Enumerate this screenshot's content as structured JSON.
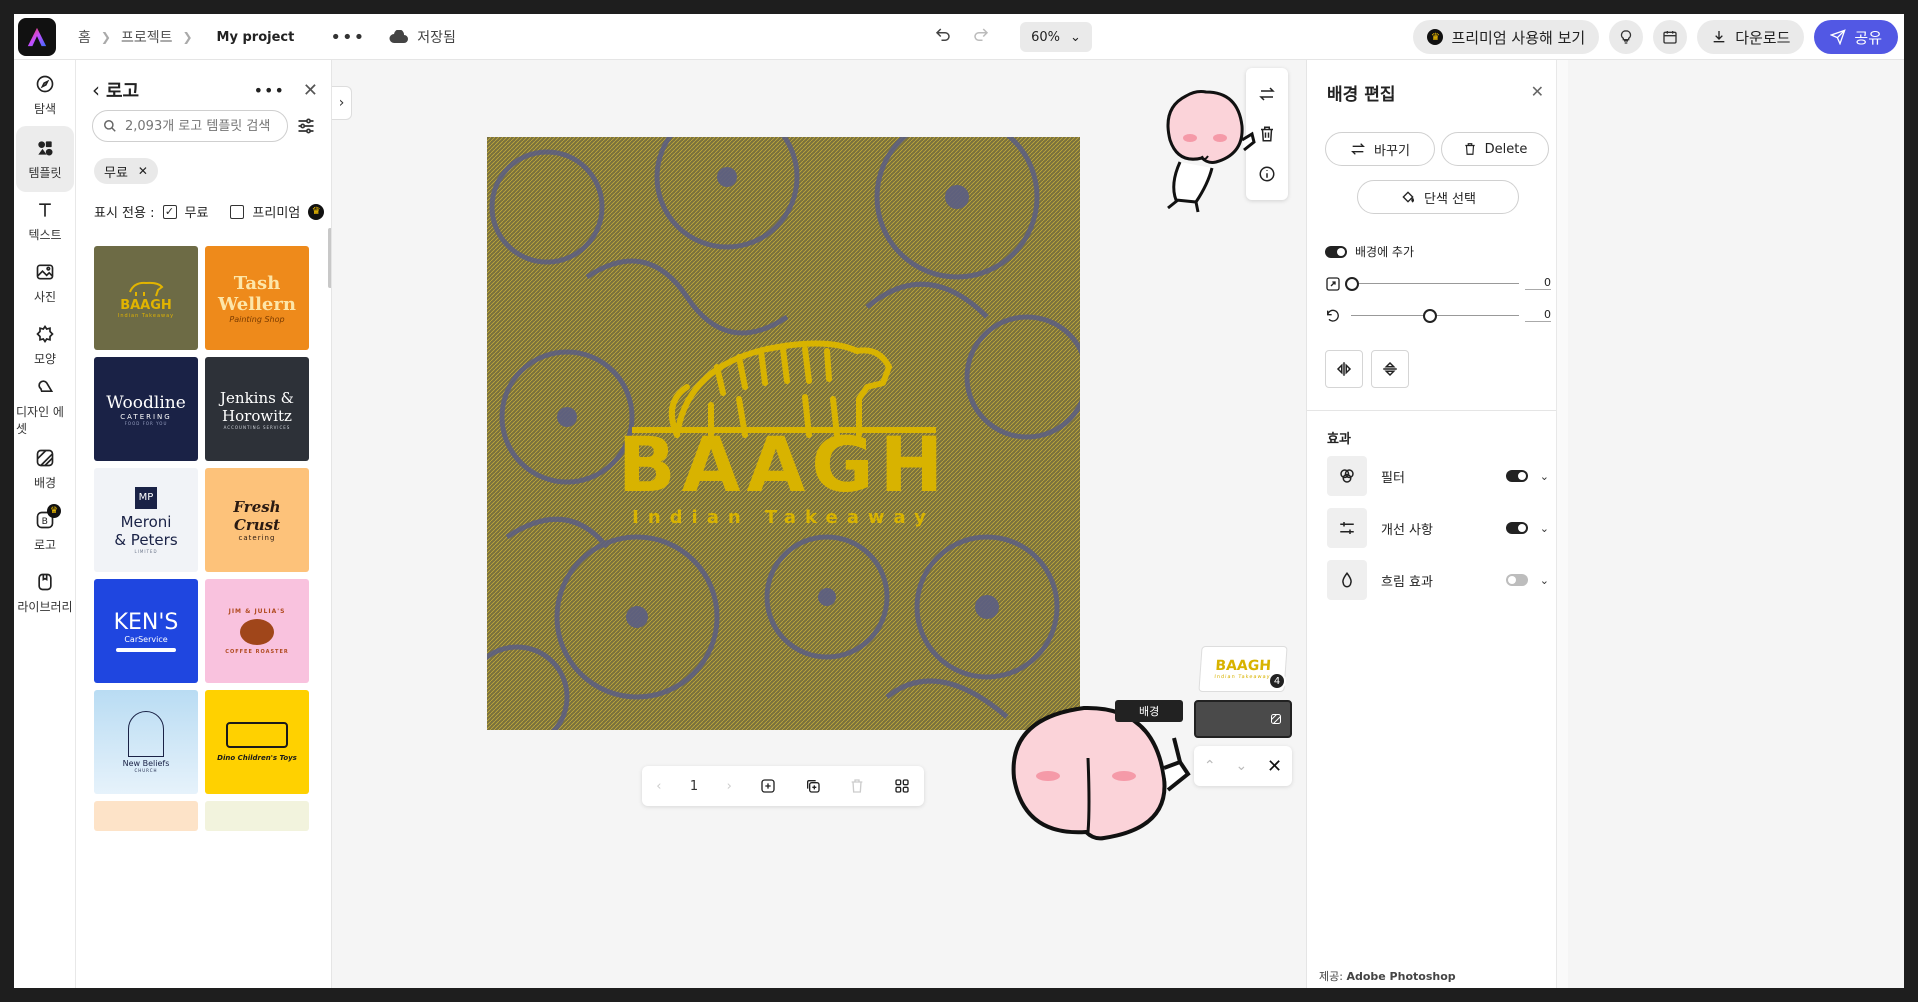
{
  "topbar": {
    "breadcrumb_home": "홈",
    "breadcrumb_projects": "프로젝트",
    "project_name": "My project",
    "more": "•••",
    "save_status": "저장됨",
    "zoom": "60%",
    "premium_label": "프리미엄 사용해 보기",
    "download_label": "다운로드",
    "share_label": "공유"
  },
  "rail": {
    "items": [
      {
        "label": "탐색",
        "icon": "compass-icon"
      },
      {
        "label": "템플릿",
        "icon": "templates-icon"
      },
      {
        "label": "텍스트",
        "icon": "text-icon"
      },
      {
        "label": "사진",
        "icon": "photo-icon"
      },
      {
        "label": "모양",
        "icon": "shapes-icon"
      },
      {
        "label": "디자인 에셋",
        "icon": "design-assets-icon"
      },
      {
        "label": "배경",
        "icon": "background-icon"
      },
      {
        "label": "로고",
        "icon": "logo-icon"
      },
      {
        "label": "라이브러리",
        "icon": "library-icon"
      }
    ]
  },
  "panel": {
    "title": "로고",
    "search_placeholder": "2,093개 로고 템플릿 검색",
    "chip": "무료",
    "show_only_label": "표시 전용 :",
    "free_label": "무료",
    "premium_label": "프리미엄",
    "tiles": [
      {
        "line1": "BAAGH",
        "line2": "Indian Takeaway",
        "bg": "#6d6b45",
        "fg": "#e2b400"
      },
      {
        "line1": "Tash",
        "line2": "Wellern",
        "line3": "Painting Shop",
        "bg": "#ee8a1b",
        "fg": "#fde6a8"
      },
      {
        "line1": "Woodline",
        "line2": "CATERING",
        "line3": "FOOD FOR YOU",
        "bg": "#1a2246",
        "fg": "#ffffff"
      },
      {
        "line1": "Jenkins &",
        "line2": "Horowitz",
        "line3": "ACCOUNTING SERVICES",
        "bg": "#2d3138",
        "fg": "#ffffff"
      },
      {
        "line1": "Meroni",
        "line2": "& Peters",
        "line3": "LIMITED",
        "bg": "#f1f3f7",
        "fg": "#1a2246"
      },
      {
        "line1": "Fresh",
        "line2": "Crust",
        "line3": "catering",
        "bg": "#fdc27a",
        "fg": "#2a1a12"
      },
      {
        "line1": "KEN'S",
        "line2": "CarService",
        "bg": "#1f46e0",
        "fg": "#ffffff"
      },
      {
        "line1": "JIM & JULIA'S",
        "line2": "COFFEE ROASTER",
        "bg": "#f9c2de",
        "fg": "#b04a1e"
      },
      {
        "line1": "New Beliefs",
        "line2": "CHURCH",
        "bg": "#b9dcf3",
        "fg": "#1a2246"
      },
      {
        "line1": "Dino Children's Toys",
        "bg": "#ffd100",
        "fg": "#1a1a1a"
      }
    ]
  },
  "canvas": {
    "logo_main": "BAAGH",
    "logo_sub": "Indian Takeaway",
    "bg_color": "#6d6a45",
    "accent": "#e2b400",
    "pattern_color": "#5b5e84"
  },
  "pager": {
    "page": "1"
  },
  "layers": {
    "count": "4",
    "tag": "배경"
  },
  "right_panel": {
    "title": "배경 편집",
    "replace_label": "바꾸기",
    "delete_label": "Delete",
    "solid_label": "단색 선택",
    "add_to_bg_label": "배경에 추가",
    "scale_value": "0",
    "rotate_value": "0",
    "effects_title": "효과",
    "effects": [
      {
        "label": "필터",
        "on": true
      },
      {
        "label": "개선 사항",
        "on": true
      },
      {
        "label": "흐림 효과",
        "on": false
      }
    ],
    "credit_prefix": "제공:",
    "credit_name": "Adobe Photoshop"
  }
}
